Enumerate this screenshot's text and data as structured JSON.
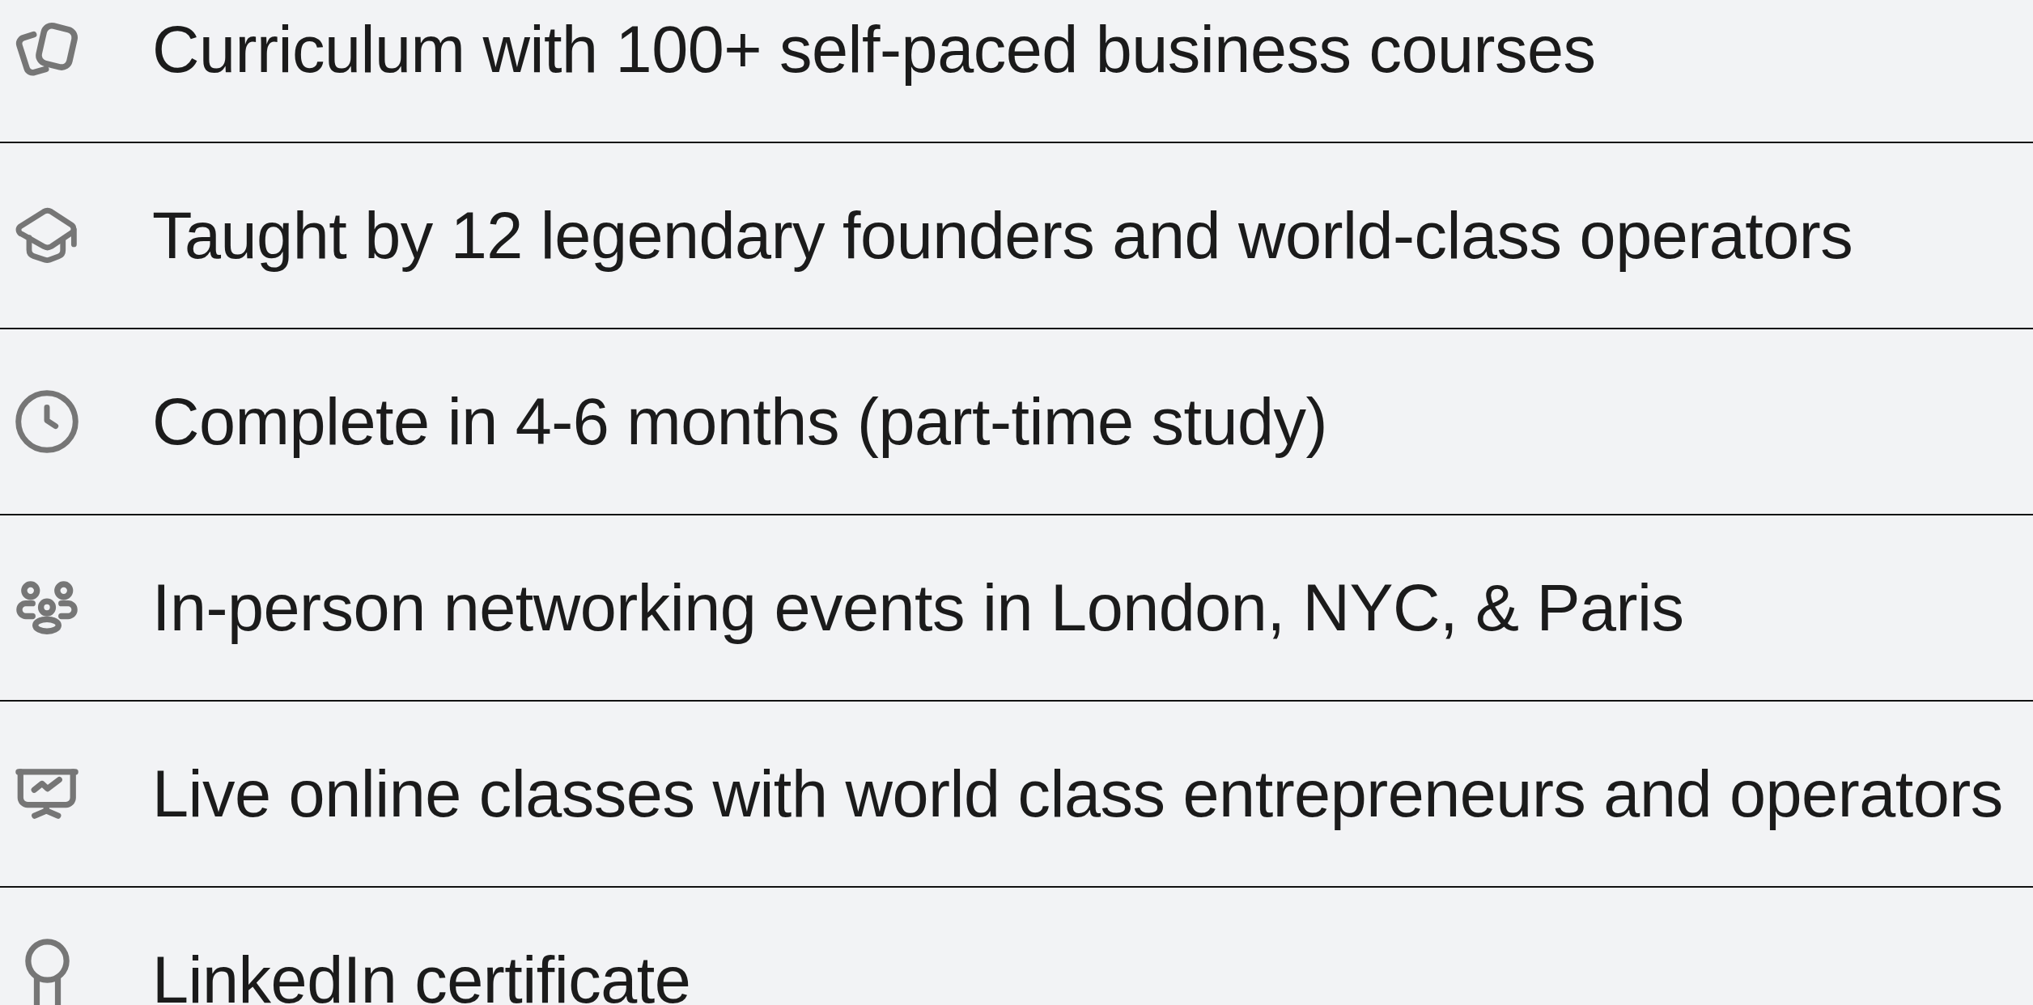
{
  "features": [
    {
      "kind": "cards",
      "text": "Curriculum with 100+ self-paced business courses"
    },
    {
      "kind": "cap",
      "text": "Taught by 12 legendary founders and world-class operators"
    },
    {
      "kind": "clock",
      "text": "Complete in 4-6 months (part-time study)"
    },
    {
      "kind": "people",
      "text": "In-person networking events in London, NYC, & Paris"
    },
    {
      "kind": "presentation",
      "text": "Live online classes with world class entrepreneurs and operators"
    },
    {
      "kind": "award",
      "text": "LinkedIn certificate"
    }
  ]
}
